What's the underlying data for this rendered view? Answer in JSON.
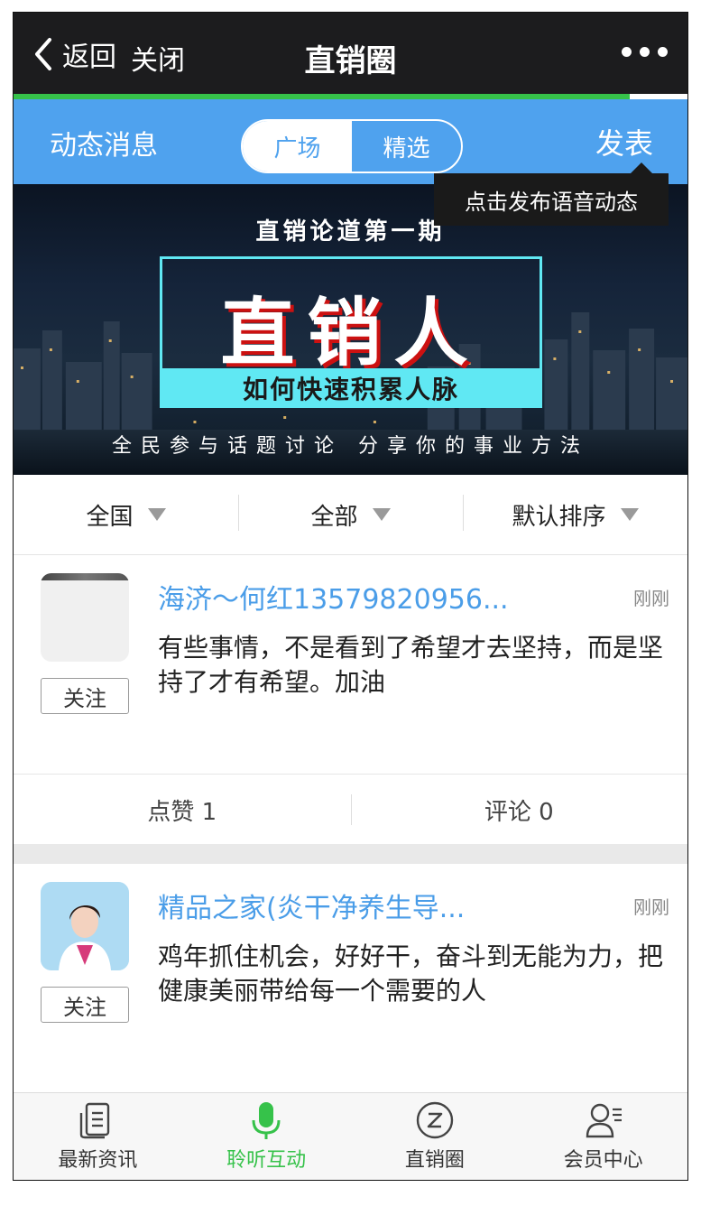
{
  "header": {
    "back_label": "返回",
    "close_label": "关闭",
    "title": "直销圈"
  },
  "nav": {
    "left_label": "动态消息",
    "segments": [
      "广场",
      "精选"
    ],
    "active_segment": "广场",
    "right_label": "发表",
    "tooltip": "点击发布语音动态"
  },
  "banner": {
    "subtitle_top": "直销论道第一期",
    "title": "直销人",
    "strip": "如何快速积累人脉",
    "subtitle_bottom": "全民参与话题讨论  分享你的事业方法"
  },
  "filters": [
    {
      "label": "全国"
    },
    {
      "label": "全部"
    },
    {
      "label": "默认排序"
    }
  ],
  "posts": [
    {
      "name": "海济～何红13579820956...",
      "time": "刚刚",
      "text": "有些事情，不是看到了希望才去坚持，而是坚持了才有希望。加油",
      "follow_label": "关注",
      "like_label": "点赞 1",
      "comment_label": "评论 0"
    },
    {
      "name": "精品之家(炎干净养生导...",
      "time": "刚刚",
      "text": "鸡年抓住机会，好好干，奋斗到无能为力，把健康美丽带给每一个需要的人",
      "follow_label": "关注"
    }
  ],
  "tabbar": [
    {
      "label": "最新资讯",
      "icon": "news-icon",
      "active": false
    },
    {
      "label": "聆听互动",
      "icon": "microphone-icon",
      "active": true
    },
    {
      "label": "直销圈",
      "icon": "circle-z-icon",
      "active": false
    },
    {
      "label": "会员中心",
      "icon": "member-icon",
      "active": false
    }
  ],
  "colors": {
    "accent_blue": "#4fa2ee",
    "active_green": "#36c24a",
    "topbar": "#1c1c1e"
  }
}
